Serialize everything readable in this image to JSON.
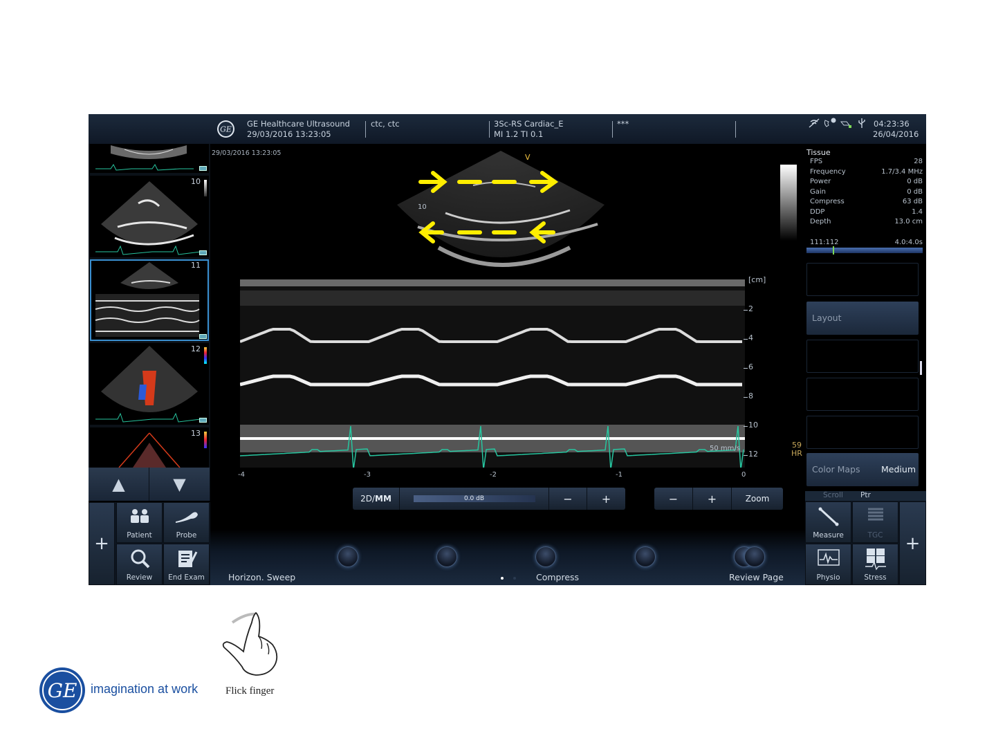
{
  "header": {
    "brand": "GE Healthcare Ultrasound",
    "exam_datetime": "29/03/2016 13:23:05",
    "patient": "ctc, ctc",
    "probe_preset": "3Sc-RS  Cardiac_E",
    "indices": "MI 1.2   TI 0.1",
    "field4": "***",
    "clock_time": "04:23:36",
    "clock_date": "26/04/2016"
  },
  "thumbnails": [
    {
      "num": ""
    },
    {
      "num": "10"
    },
    {
      "num": "11"
    },
    {
      "num": "12"
    },
    {
      "num": "13"
    }
  ],
  "image": {
    "date": "29/03/2016 13:23:05",
    "sector_marker": "V",
    "sector_depth": "10",
    "depth_unit": "[cm]",
    "depth_ticks": [
      "2",
      "4",
      "6",
      "8",
      "10",
      "12"
    ],
    "time_ticks": [
      "-4",
      "-3",
      "-2",
      "-1",
      "0"
    ],
    "sweep_speed": "50 mm/s",
    "hr_value": "59",
    "hr_label": "HR"
  },
  "tissue": {
    "title": "Tissue",
    "rows": [
      {
        "k": "FPS",
        "v": "28"
      },
      {
        "k": "Frequency",
        "v": "1.7/3.4 MHz"
      },
      {
        "k": "Power",
        "v": "0 dB"
      },
      {
        "k": "Gain",
        "v": "0 dB"
      },
      {
        "k": "Compress",
        "v": "63 dB"
      },
      {
        "k": "DDP",
        "v": "1.4"
      },
      {
        "k": "Depth",
        "v": "13.0 cm"
      }
    ],
    "cine_left": "111:112",
    "cine_right": "4.0:4.0s"
  },
  "right_buttons": {
    "layout": "Layout",
    "color_maps": "Color Maps",
    "color_maps_value": "Medium",
    "scroll": "Scroll",
    "ptr": "Ptr"
  },
  "controls": {
    "mode": "2D/",
    "mode_bold": "MM",
    "gain": "0.0 dB",
    "minus": "−",
    "plus": "+",
    "zoom": "Zoom"
  },
  "left_buttons": {
    "patient": "Patient",
    "probe": "Probe",
    "review": "Review",
    "end_exam": "End Exam"
  },
  "right_grid": {
    "measure": "Measure",
    "tgc": "TGC",
    "physio": "Physio",
    "stress": "Stress"
  },
  "bottom": {
    "horizon_sweep": "Horizon. Sweep",
    "compress": "Compress",
    "review_page": "Review Page"
  },
  "footer": {
    "logo_text": "GE",
    "tagline": "imagination at work",
    "gesture_caption": "Flick finger"
  },
  "colors": {
    "arrow_yellow": "#ffee00",
    "ecg_green": "#27c6a0",
    "panel_blue": "#1c2a3c",
    "ge_blue": "#1a4fa0"
  }
}
